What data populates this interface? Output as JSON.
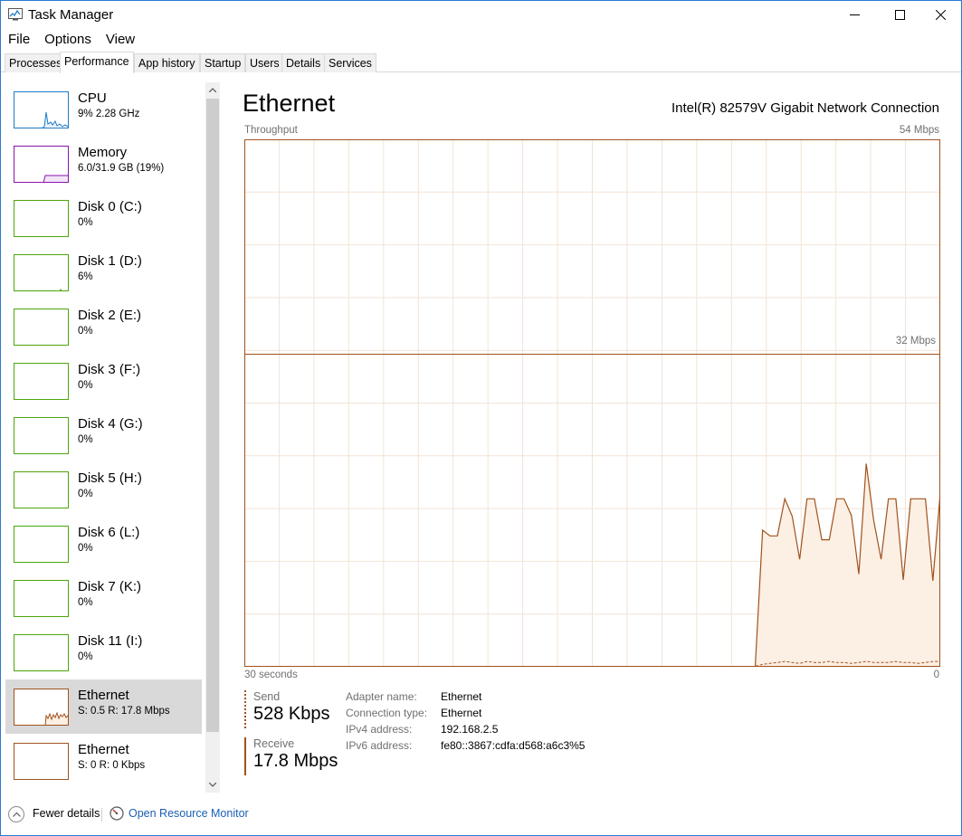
{
  "window": {
    "title": "Task Manager",
    "accent_color": "#2a7ad4"
  },
  "menu": {
    "items": [
      "File",
      "Options",
      "View"
    ]
  },
  "tabs": [
    {
      "label": "Processes",
      "active": false
    },
    {
      "label": "Performance",
      "active": true
    },
    {
      "label": "App history",
      "active": false
    },
    {
      "label": "Startup",
      "active": false
    },
    {
      "label": "Users",
      "active": false
    },
    {
      "label": "Details",
      "active": false
    },
    {
      "label": "Services",
      "active": false
    }
  ],
  "sidebar": {
    "items": [
      {
        "name": "CPU",
        "value": "9%  2.28 GHz",
        "color": "#1c7cc9",
        "icon": "cpu-graph-icon"
      },
      {
        "name": "Memory",
        "value": "6.0/31.9 GB (19%)",
        "color": "#8b12ae",
        "icon": "memory-graph-icon"
      },
      {
        "name": "Disk 0 (C:)",
        "value": "0%",
        "color": "#4da60c",
        "icon": "disk-graph-icon"
      },
      {
        "name": "Disk 1 (D:)",
        "value": "6%",
        "color": "#4da60c",
        "icon": "disk-graph-icon"
      },
      {
        "name": "Disk 2 (E:)",
        "value": "0%",
        "color": "#4da60c",
        "icon": "disk-graph-icon"
      },
      {
        "name": "Disk 3 (F:)",
        "value": "0%",
        "color": "#4da60c",
        "icon": "disk-graph-icon"
      },
      {
        "name": "Disk 4 (G:)",
        "value": "0%",
        "color": "#4da60c",
        "icon": "disk-graph-icon"
      },
      {
        "name": "Disk 5 (H:)",
        "value": "0%",
        "color": "#4da60c",
        "icon": "disk-graph-icon"
      },
      {
        "name": "Disk 6 (L:)",
        "value": "0%",
        "color": "#4da60c",
        "icon": "disk-graph-icon"
      },
      {
        "name": "Disk 7 (K:)",
        "value": "0%",
        "color": "#4da60c",
        "icon": "disk-graph-icon"
      },
      {
        "name": "Disk 11 (I:)",
        "value": "0%",
        "color": "#4da60c",
        "icon": "disk-graph-icon"
      },
      {
        "name": "Ethernet",
        "value": "S: 0.5  R: 17.8 Mbps",
        "color": "#a0521e",
        "icon": "ethernet-graph-icon",
        "active": true
      },
      {
        "name": "Ethernet",
        "value": "S: 0  R: 0 Kbps",
        "color": "#a0521e",
        "icon": "ethernet-graph-icon"
      }
    ]
  },
  "main": {
    "title": "Ethernet",
    "adapter": "Intel(R) 82579V Gigabit Network Connection",
    "throughput_label": "Throughput",
    "max_label": "54 Mbps",
    "mid_label": "32 Mbps",
    "time_label": "30 seconds",
    "zero_label": "0",
    "graph_color": "#a0521e",
    "graph_fill": "#fcefe3",
    "grid_color": "#f2e4d6"
  },
  "throughput": {
    "max_mbps": 54,
    "mid_mbps": 32,
    "receive_series": [
      0,
      0,
      0,
      0,
      0,
      0,
      0,
      0,
      0,
      0,
      0,
      0,
      0,
      0,
      0,
      0,
      0,
      0,
      0,
      0,
      0,
      0,
      0,
      0,
      0,
      0,
      0,
      0,
      0,
      0,
      0,
      0,
      0,
      0,
      0,
      0,
      0,
      0,
      0,
      0,
      0,
      0,
      0,
      0,
      0,
      0,
      0,
      0,
      0,
      0,
      0,
      0,
      0,
      0,
      0,
      0,
      0,
      0,
      0,
      0,
      0,
      0,
      0,
      0,
      0,
      0,
      0,
      0,
      0,
      0,
      14,
      13.4,
      13.4,
      17.2,
      15.4,
      11,
      17.2,
      17.2,
      13,
      13,
      17.2,
      17.2,
      15.5,
      9.5,
      20.8,
      15,
      11,
      17.2,
      17.2,
      8.9,
      17.2,
      17.2,
      17.2,
      8.8,
      17.8
    ],
    "send_series": [
      0,
      0,
      0,
      0,
      0,
      0,
      0,
      0,
      0,
      0,
      0,
      0,
      0,
      0,
      0,
      0,
      0,
      0,
      0,
      0,
      0,
      0,
      0,
      0,
      0,
      0,
      0,
      0,
      0,
      0,
      0,
      0,
      0,
      0,
      0,
      0,
      0,
      0,
      0,
      0,
      0,
      0,
      0,
      0,
      0,
      0,
      0,
      0,
      0,
      0,
      0,
      0,
      0,
      0,
      0,
      0,
      0,
      0,
      0,
      0,
      0,
      0,
      0,
      0,
      0,
      0,
      0,
      0,
      0,
      0,
      0.2,
      0.3,
      0.4,
      0.5,
      0.4,
      0.3,
      0.5,
      0.4,
      0.4,
      0.5,
      0.4,
      0.4,
      0.3,
      0.4,
      0.5,
      0.4,
      0.4,
      0.4,
      0.5,
      0.4,
      0.4,
      0.3,
      0.4,
      0.5,
      0.5
    ]
  },
  "stats": {
    "send_label": "Send",
    "send_value": "528 Kbps",
    "receive_label": "Receive",
    "receive_value": "17.8 Mbps"
  },
  "properties": [
    {
      "label": "Adapter name:",
      "value": "Ethernet"
    },
    {
      "label": "Connection type:",
      "value": "Ethernet"
    },
    {
      "label": "IPv4 address:",
      "value": "192.168.2.5"
    },
    {
      "label": "IPv6 address:",
      "value": "fe80::3867:cdfa:d568:a6c3%5"
    }
  ],
  "footer": {
    "fewer_details": "Fewer details",
    "resource_monitor": "Open Resource Monitor"
  }
}
